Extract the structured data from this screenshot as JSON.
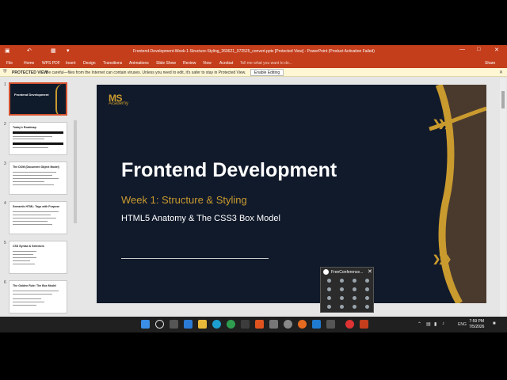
{
  "window": {
    "title": "Frontend-Development-Week-1-Structure-Styling_260621_072525_convert.pptx [Protected View] - PowerPoint (Product Activation Failed)"
  },
  "ribbon": {
    "tabs": [
      "File",
      "Home",
      "WPS PDF",
      "Insert",
      "Design",
      "Transitions",
      "Animations",
      "Slide Show",
      "Review",
      "View",
      "Acrobat"
    ],
    "tell_me": "Tell me what you want to do...",
    "share": "Share"
  },
  "protected_view": {
    "label": "PROTECTED VIEW",
    "message": "Be careful—files from the Internet can contain viruses. Unless you need to edit, it's safer to stay in Protected View.",
    "button": "Enable Editing"
  },
  "thumbnails": [
    {
      "num": "1",
      "title": "Frontend Development",
      "selected": true
    },
    {
      "num": "2",
      "title": "Today's Roadmap"
    },
    {
      "num": "3",
      "title": "The DOM (Document Object Model)"
    },
    {
      "num": "4",
      "title": "Semantic HTML: Tags with Purpose"
    },
    {
      "num": "5",
      "title": "CSS Syntax & Selectors"
    },
    {
      "num": "6",
      "title": "The Golden Rule: The Box Model"
    }
  ],
  "slide": {
    "logo_main": "MS",
    "logo_sub": "Academy",
    "title": "Frontend Development",
    "subtitle": "Week 1: Structure & Styling",
    "tagline": "HTML5 Anatomy & The CSS3 Box Model"
  },
  "conference": {
    "title": "FreeConference..."
  },
  "taskbar": {
    "lang": "ENG",
    "time": "7:59 PM",
    "date": "7/5/2026"
  }
}
